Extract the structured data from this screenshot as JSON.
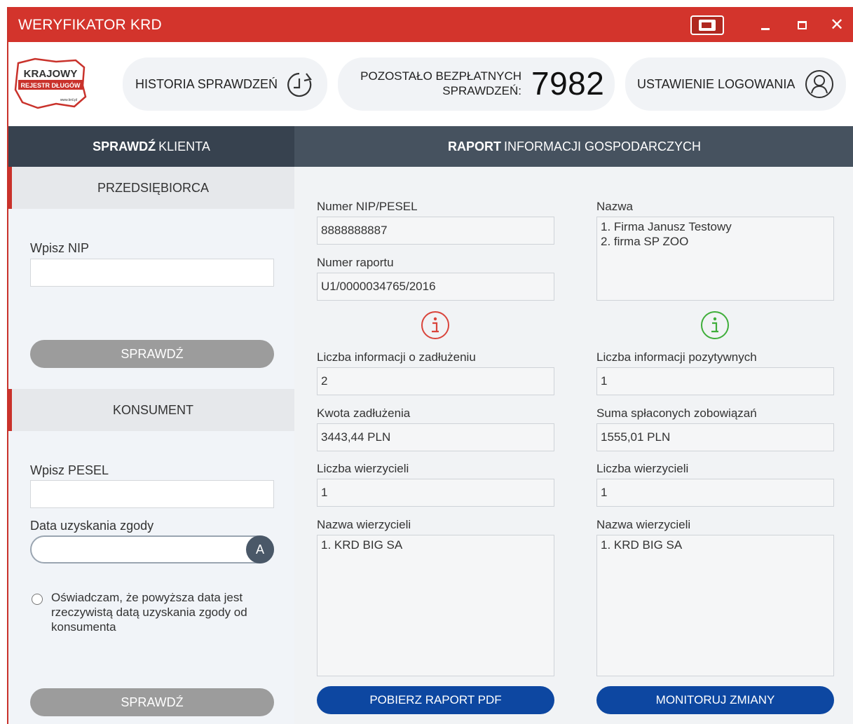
{
  "window": {
    "title": "WERYFIKATOR KRD"
  },
  "header": {
    "logo_text": "KRAJOWY",
    "logo_sub": "REJESTR DŁUGÓW",
    "logo_url": "www.krd.pl",
    "history_label": "HISTORIA SPRAWDZEŃ",
    "remaining_label_1": "POZOSTAŁO BEZPŁATNYCH",
    "remaining_label_2": "SPRAWDZEŃ:",
    "remaining_count": "7982",
    "login_label": "USTAWIENIE LOGOWANIA"
  },
  "left_header": {
    "bold": "SPRAWDŹ",
    "rest": "KLIENTA"
  },
  "right_header": {
    "bold": "RAPORT",
    "rest": "INFORMACJI GOSPODARCZYCH"
  },
  "business": {
    "heading": "PRZEDSIĘBIORCA",
    "nip_label": "Wpisz NIP",
    "nip_value": "",
    "check_label": "SPRAWDŹ"
  },
  "consumer": {
    "heading": "KONSUMENT",
    "pesel_label": "Wpisz PESEL",
    "pesel_value": "",
    "consent_date_label": "Data uzyskania zgody",
    "consent_date_value": "",
    "date_button": "A",
    "declaration": "Oświadczam, że powyższa data jest rzeczywistą datą uzyskania zgody od konsumenta",
    "check_label": "SPRAWDŹ"
  },
  "report": {
    "nip_label": "Numer NIP/PESEL",
    "nip_value": "8888888887",
    "report_no_label": "Numer raportu",
    "report_no_value": "U1/0000034765/2016",
    "name_label": "Nazwa",
    "names": [
      "1.  Firma Janusz Testowy",
      "2.  firma SP ZOO"
    ],
    "debt_count_label": "Liczba informacji o zadłużeniu",
    "debt_count_value": "2",
    "debt_amount_label": "Kwota zadłużenia",
    "debt_amount_value": "3443,44 PLN",
    "debt_creditors_count_label": "Liczba wierzycieli",
    "debt_creditors_count_value": "1",
    "debt_creditors_name_label": "Nazwa wierzycieli",
    "debt_creditors_names": [
      "1.  KRD BIG SA"
    ],
    "positive_count_label": "Liczba informacji pozytywnych",
    "positive_count_value": "1",
    "repaid_sum_label": "Suma spłaconych zobowiązań",
    "repaid_sum_value": "1555,01 PLN",
    "positive_creditors_count_label": "Liczba wierzycieli",
    "positive_creditors_count_value": "1",
    "positive_creditors_name_label": "Nazwa wierzycieli",
    "positive_creditors_names": [
      "1.  KRD BIG SA"
    ],
    "pdf_button": "POBIERZ RAPORT PDF",
    "monitor_button": "MONITORUJ ZMIANY"
  },
  "icons": {
    "debt_info": "info-icon-red",
    "positive_info": "info-icon-green",
    "history": "history-icon",
    "user": "user-icon"
  },
  "colors": {
    "titlebar": "#d3342c",
    "dark_header": "#37424f",
    "primary_button": "#0d47a1",
    "disabled_button": "#9c9c9c",
    "debt_red": "#d9443b",
    "positive_green": "#3fae3a"
  }
}
